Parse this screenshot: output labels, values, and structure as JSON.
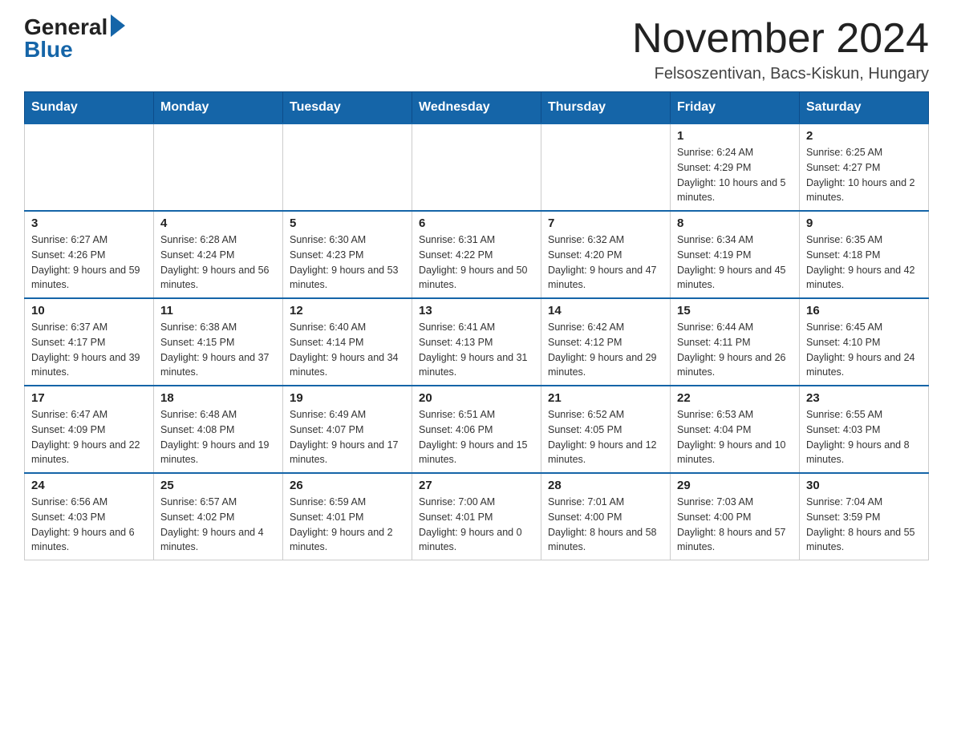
{
  "logo": {
    "general": "General",
    "blue": "Blue"
  },
  "title": "November 2024",
  "subtitle": "Felsoszentivan, Bacs-Kiskun, Hungary",
  "weekdays": [
    "Sunday",
    "Monday",
    "Tuesday",
    "Wednesday",
    "Thursday",
    "Friday",
    "Saturday"
  ],
  "weeks": [
    [
      {
        "day": "",
        "info": ""
      },
      {
        "day": "",
        "info": ""
      },
      {
        "day": "",
        "info": ""
      },
      {
        "day": "",
        "info": ""
      },
      {
        "day": "",
        "info": ""
      },
      {
        "day": "1",
        "info": "Sunrise: 6:24 AM\nSunset: 4:29 PM\nDaylight: 10 hours and 5 minutes."
      },
      {
        "day": "2",
        "info": "Sunrise: 6:25 AM\nSunset: 4:27 PM\nDaylight: 10 hours and 2 minutes."
      }
    ],
    [
      {
        "day": "3",
        "info": "Sunrise: 6:27 AM\nSunset: 4:26 PM\nDaylight: 9 hours and 59 minutes."
      },
      {
        "day": "4",
        "info": "Sunrise: 6:28 AM\nSunset: 4:24 PM\nDaylight: 9 hours and 56 minutes."
      },
      {
        "day": "5",
        "info": "Sunrise: 6:30 AM\nSunset: 4:23 PM\nDaylight: 9 hours and 53 minutes."
      },
      {
        "day": "6",
        "info": "Sunrise: 6:31 AM\nSunset: 4:22 PM\nDaylight: 9 hours and 50 minutes."
      },
      {
        "day": "7",
        "info": "Sunrise: 6:32 AM\nSunset: 4:20 PM\nDaylight: 9 hours and 47 minutes."
      },
      {
        "day": "8",
        "info": "Sunrise: 6:34 AM\nSunset: 4:19 PM\nDaylight: 9 hours and 45 minutes."
      },
      {
        "day": "9",
        "info": "Sunrise: 6:35 AM\nSunset: 4:18 PM\nDaylight: 9 hours and 42 minutes."
      }
    ],
    [
      {
        "day": "10",
        "info": "Sunrise: 6:37 AM\nSunset: 4:17 PM\nDaylight: 9 hours and 39 minutes."
      },
      {
        "day": "11",
        "info": "Sunrise: 6:38 AM\nSunset: 4:15 PM\nDaylight: 9 hours and 37 minutes."
      },
      {
        "day": "12",
        "info": "Sunrise: 6:40 AM\nSunset: 4:14 PM\nDaylight: 9 hours and 34 minutes."
      },
      {
        "day": "13",
        "info": "Sunrise: 6:41 AM\nSunset: 4:13 PM\nDaylight: 9 hours and 31 minutes."
      },
      {
        "day": "14",
        "info": "Sunrise: 6:42 AM\nSunset: 4:12 PM\nDaylight: 9 hours and 29 minutes."
      },
      {
        "day": "15",
        "info": "Sunrise: 6:44 AM\nSunset: 4:11 PM\nDaylight: 9 hours and 26 minutes."
      },
      {
        "day": "16",
        "info": "Sunrise: 6:45 AM\nSunset: 4:10 PM\nDaylight: 9 hours and 24 minutes."
      }
    ],
    [
      {
        "day": "17",
        "info": "Sunrise: 6:47 AM\nSunset: 4:09 PM\nDaylight: 9 hours and 22 minutes."
      },
      {
        "day": "18",
        "info": "Sunrise: 6:48 AM\nSunset: 4:08 PM\nDaylight: 9 hours and 19 minutes."
      },
      {
        "day": "19",
        "info": "Sunrise: 6:49 AM\nSunset: 4:07 PM\nDaylight: 9 hours and 17 minutes."
      },
      {
        "day": "20",
        "info": "Sunrise: 6:51 AM\nSunset: 4:06 PM\nDaylight: 9 hours and 15 minutes."
      },
      {
        "day": "21",
        "info": "Sunrise: 6:52 AM\nSunset: 4:05 PM\nDaylight: 9 hours and 12 minutes."
      },
      {
        "day": "22",
        "info": "Sunrise: 6:53 AM\nSunset: 4:04 PM\nDaylight: 9 hours and 10 minutes."
      },
      {
        "day": "23",
        "info": "Sunrise: 6:55 AM\nSunset: 4:03 PM\nDaylight: 9 hours and 8 minutes."
      }
    ],
    [
      {
        "day": "24",
        "info": "Sunrise: 6:56 AM\nSunset: 4:03 PM\nDaylight: 9 hours and 6 minutes."
      },
      {
        "day": "25",
        "info": "Sunrise: 6:57 AM\nSunset: 4:02 PM\nDaylight: 9 hours and 4 minutes."
      },
      {
        "day": "26",
        "info": "Sunrise: 6:59 AM\nSunset: 4:01 PM\nDaylight: 9 hours and 2 minutes."
      },
      {
        "day": "27",
        "info": "Sunrise: 7:00 AM\nSunset: 4:01 PM\nDaylight: 9 hours and 0 minutes."
      },
      {
        "day": "28",
        "info": "Sunrise: 7:01 AM\nSunset: 4:00 PM\nDaylight: 8 hours and 58 minutes."
      },
      {
        "day": "29",
        "info": "Sunrise: 7:03 AM\nSunset: 4:00 PM\nDaylight: 8 hours and 57 minutes."
      },
      {
        "day": "30",
        "info": "Sunrise: 7:04 AM\nSunset: 3:59 PM\nDaylight: 8 hours and 55 minutes."
      }
    ]
  ]
}
